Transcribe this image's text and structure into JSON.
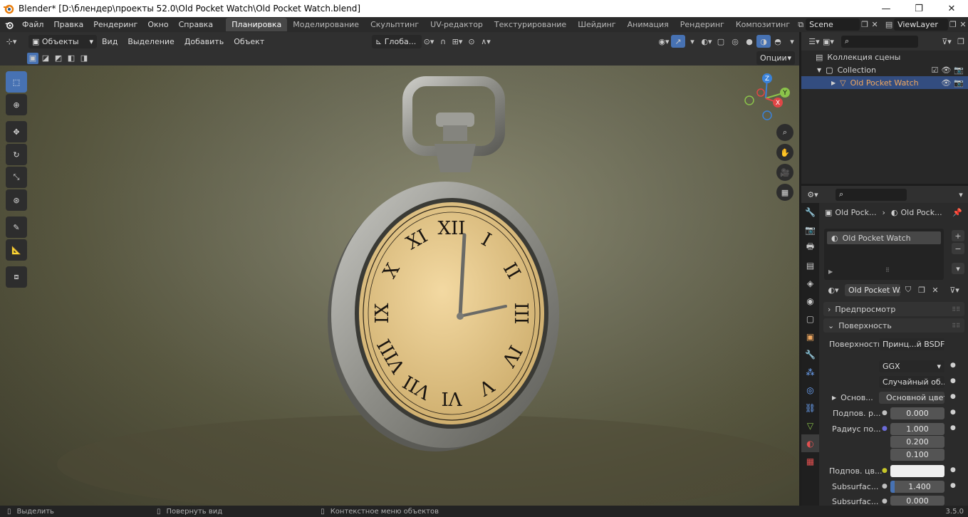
{
  "titlebar": {
    "title": "Blender* [D:\\блендер\\проекты 52.0\\Old Pocket Watch\\Old Pocket Watch.blend]",
    "minimize": "—",
    "maximize": "❐",
    "close": "✕"
  },
  "menu": {
    "items": [
      "Файл",
      "Правка",
      "Рендеринг",
      "Окно",
      "Справка"
    ],
    "workspaces": [
      "Планировка",
      "Моделирование",
      "Скульптинг",
      "UV-редактор",
      "Текстурирование",
      "Шейдинг",
      "Анимация",
      "Рендеринг",
      "Композитинг"
    ],
    "active_workspace": "Планировка",
    "scene": "Scene",
    "view_layer": "ViewLayer"
  },
  "viewport_header": {
    "mode": "Объекты",
    "menus": [
      "Вид",
      "Выделение",
      "Добавить",
      "Объект"
    ],
    "transform": "Глоба...",
    "options": "Опции"
  },
  "outliner": {
    "scene_collection": "Коллекция сцены",
    "collection": "Collection",
    "object": "Old Pocket Watch"
  },
  "properties": {
    "breadcrumb_object": "Old Pock...",
    "breadcrumb_material": "Old Pock...",
    "slot_name": "Old Pocket Watch",
    "material_name": "Old Pocket W...",
    "panel_preview": "Предпросмотр",
    "panel_surface": "Поверхность",
    "surface_label": "Поверхность",
    "surface_value": "Принц...й BSDF",
    "distribution": "GGX",
    "subsurface_method": "Случайный об...",
    "base_label": "Основ...",
    "base_value": "Основной цвет",
    "subsurface_label": "Подпов. р...",
    "subsurface_value": "0.000",
    "radius_label": "Радиус по...",
    "radius_values": [
      "1.000",
      "0.200",
      "0.100"
    ],
    "subsurface_color_label": "Подпов. цв...",
    "subsurface_ior_label": "Subsurfac...",
    "subsurface_ior_value": "1.400",
    "subsurface_aniso_label": "Subsurfac...",
    "subsurface_aniso_value": "0.000"
  },
  "status": {
    "select": "Выделить",
    "rotate": "Повернуть вид",
    "context": "Контекстное меню объектов",
    "version": "3.5.0"
  },
  "clock": {
    "numerals": [
      "XII",
      "I",
      "II",
      "III",
      "IV",
      "V",
      "VI",
      "VII",
      "VIII",
      "IX",
      "X",
      "XI"
    ]
  },
  "gizmo": {
    "x": "X",
    "y": "Y",
    "z": "Z"
  },
  "colors": {
    "accent": "#4772b3",
    "selected_row": "#334d80",
    "object_orange": "#f0a860"
  }
}
